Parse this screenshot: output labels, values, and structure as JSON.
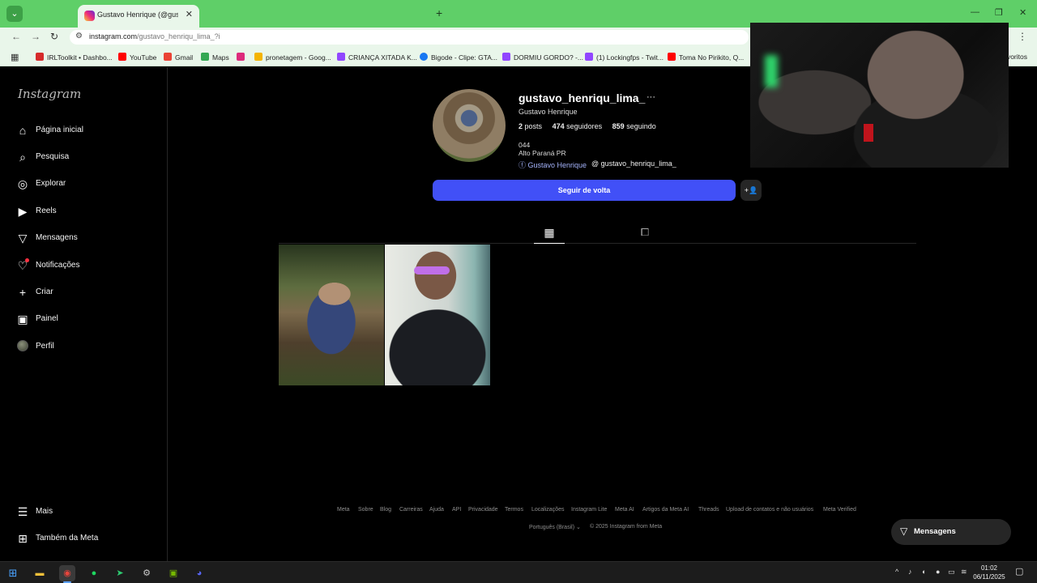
{
  "browser": {
    "tab_title": "Gustavo Henrique (@gustavo",
    "url_host": "instagram.com",
    "url_path": "/gustavo_henriqu_lima_?i",
    "bookmarks": [
      "IRLToolkit • Dashbo...",
      "YouTube",
      "Gmail",
      "Maps",
      "",
      "pronetagem - Goog...",
      "CRIANÇA XITADA K...",
      "Bigode - Clipe: GTA...",
      "DORMIU GORDO? -...",
      "(1) Lockingfps - Twit...",
      "Toma No Pirikito, Q..."
    ],
    "bookmarks_tail": "voritos"
  },
  "instagram": {
    "logo": "Instagram",
    "nav": [
      {
        "label": "Página inicial"
      },
      {
        "label": "Pesquisa"
      },
      {
        "label": "Explorar"
      },
      {
        "label": "Reels"
      },
      {
        "label": "Mensagens"
      },
      {
        "label": "Notificações"
      },
      {
        "label": "Criar"
      },
      {
        "label": "Painel"
      },
      {
        "label": "Perfil"
      }
    ],
    "more_label": "Mais",
    "meta_label": "Também da Meta",
    "profile": {
      "username": "gustavo_henriqu_lima_",
      "full_name": "Gustavo Henrique",
      "posts_count": "2",
      "posts_label": "posts",
      "followers_count": "474",
      "followers_label": "seguidores",
      "following_count": "859",
      "following_label": "seguindo",
      "bio_line1": "044",
      "bio_line2": "Alto Paraná PR",
      "facebook_link": "Gustavo Henrique",
      "threads_link": "gustavo_henriqu_lima_",
      "follow_button": "Seguir de volta"
    },
    "footer_links": [
      "Meta",
      "Sobre",
      "Blog",
      "Carreiras",
      "Ajuda",
      "API",
      "Privacidade",
      "Termos",
      "Localizações",
      "Instagram Lite",
      "Meta AI",
      "Artigos da Meta AI",
      "Threads",
      "Upload de contatos e não usuários",
      "Meta Verified"
    ],
    "language": "Português (Brasil)",
    "copyright": "© 2025 Instagram from Meta",
    "messages_pill": "Mensagens"
  },
  "taskbar": {
    "time": "01:02",
    "date": "06/11/2025"
  }
}
